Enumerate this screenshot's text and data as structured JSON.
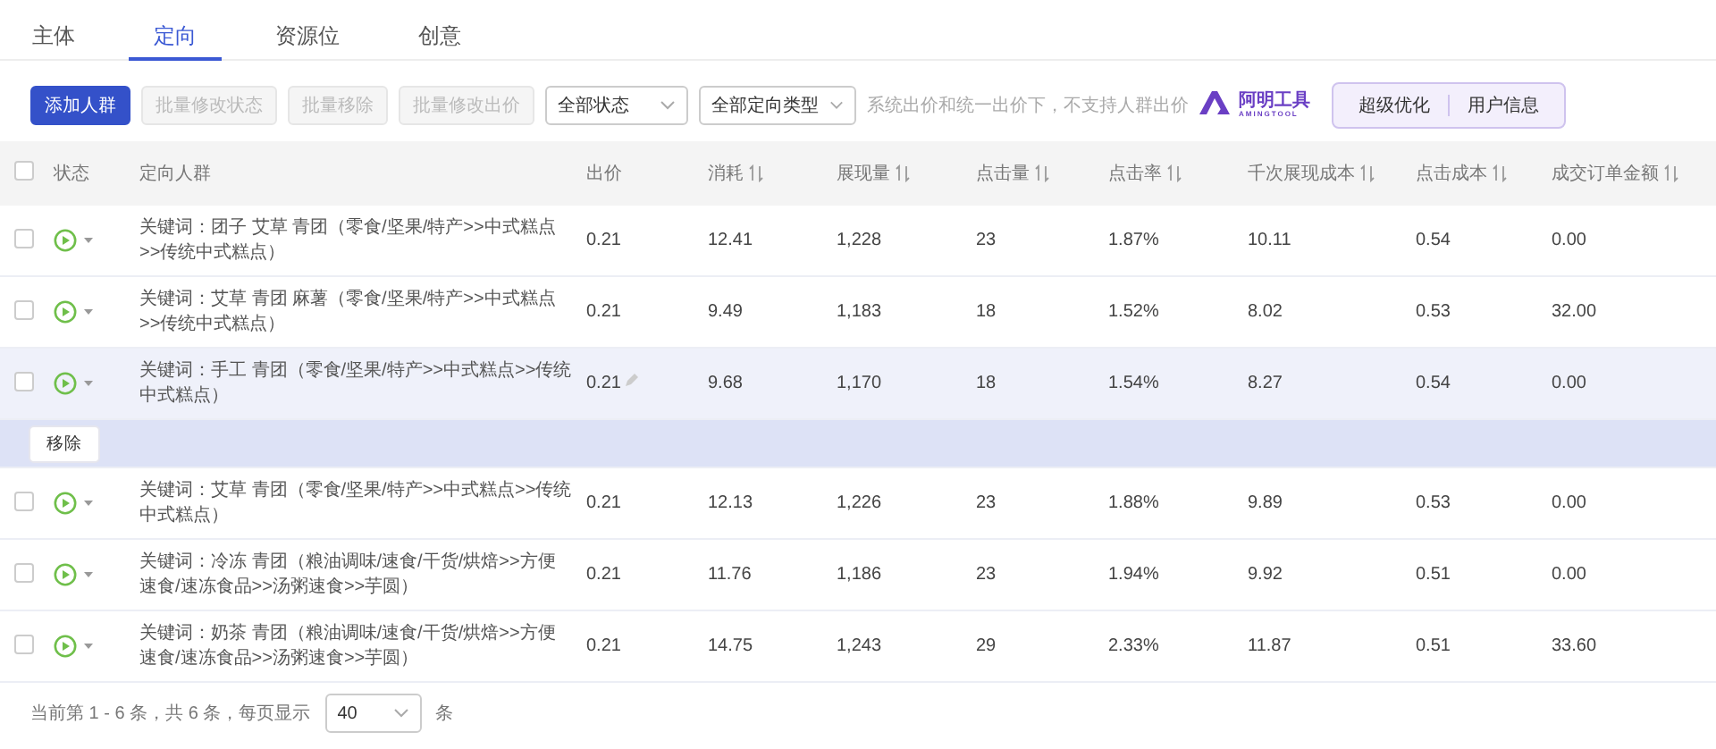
{
  "tabs": [
    {
      "label": "主体",
      "selected": false
    },
    {
      "label": "定向",
      "selected": true
    },
    {
      "label": "资源位",
      "selected": false
    },
    {
      "label": "创意",
      "selected": false
    }
  ],
  "toolbar": {
    "buttons": [
      {
        "label": "添加人群",
        "kind": "primary",
        "disabled": false
      },
      {
        "label": "批量修改状态",
        "kind": "default",
        "disabled": true
      },
      {
        "label": "批量移除",
        "kind": "default",
        "disabled": true
      },
      {
        "label": "批量修改出价",
        "kind": "default",
        "disabled": true
      }
    ],
    "selects": [
      {
        "value": "全部状态"
      },
      {
        "value": "全部定向类型"
      }
    ],
    "hint": "系统出价和统一出价下，不支持人群出价",
    "logo": {
      "name": "阿明工具",
      "subtitle": "AMINGTOOL"
    },
    "tool_tabs": [
      "超级优化",
      "用户信息"
    ]
  },
  "table": {
    "header_checked": false,
    "columns": [
      {
        "label": "状态",
        "sortable": false
      },
      {
        "label": "定向人群",
        "sortable": false
      },
      {
        "label": "出价",
        "sortable": false
      },
      {
        "label": "消耗",
        "sortable": true
      },
      {
        "label": "展现量",
        "sortable": true
      },
      {
        "label": "点击量",
        "sortable": true
      },
      {
        "label": "点击率",
        "sortable": true
      },
      {
        "label": "千次展现成本",
        "sortable": true
      },
      {
        "label": "点击成本",
        "sortable": true
      },
      {
        "label": "成交订单金额",
        "sortable": true
      }
    ],
    "rows": [
      {
        "checked": false,
        "running": true,
        "highlighted": false,
        "cells": [
          "",
          "关键词：团子 艾草 青团（零食/坚果/特产>>中式糕点>>传统中式糕点）",
          "0.21",
          "12.41",
          "1,228",
          "23",
          "1.87%",
          "10.11",
          "0.54",
          "0.00"
        ]
      },
      {
        "checked": false,
        "running": true,
        "highlighted": false,
        "cells": [
          "",
          "关键词：艾草 青团 麻薯（零食/坚果/特产>>中式糕点>>传统中式糕点）",
          "0.21",
          "9.49",
          "1,183",
          "18",
          "1.52%",
          "8.02",
          "0.53",
          "32.00"
        ]
      },
      {
        "checked": false,
        "running": true,
        "highlighted": true,
        "cells": [
          "",
          "关键词：手工 青团（零食/坚果/特产>>中式糕点>>传统中式糕点）",
          "0.21",
          "9.68",
          "1,170",
          "18",
          "1.54%",
          "8.27",
          "0.54",
          "0.00"
        ],
        "actions": [
          "移除"
        ]
      },
      {
        "checked": false,
        "running": true,
        "highlighted": false,
        "cells": [
          "",
          "关键词：艾草 青团（零食/坚果/特产>>中式糕点>>传统中式糕点）",
          "0.21",
          "12.13",
          "1,226",
          "23",
          "1.88%",
          "9.89",
          "0.53",
          "0.00"
        ]
      },
      {
        "checked": false,
        "running": true,
        "highlighted": false,
        "cells": [
          "",
          "关键词：冷冻 青团（粮油调味/速食/干货/烘焙>>方便速食/速冻食品>>汤粥速食>>芋圆）",
          "0.21",
          "11.76",
          "1,186",
          "23",
          "1.94%",
          "9.92",
          "0.51",
          "0.00"
        ]
      },
      {
        "checked": false,
        "running": true,
        "highlighted": false,
        "cells": [
          "",
          "关键词：奶茶 青团（粮油调味/速食/干货/烘焙>>方便速食/速冻食品>>汤粥速食>>芋圆）",
          "0.21",
          "14.75",
          "1,243",
          "29",
          "2.33%",
          "11.87",
          "0.51",
          "33.60"
        ]
      }
    ]
  },
  "pagination": {
    "summary": "当前第 1 - 6 条，共 6 条，每页显示",
    "page_size": "40",
    "unit": "条"
  }
}
